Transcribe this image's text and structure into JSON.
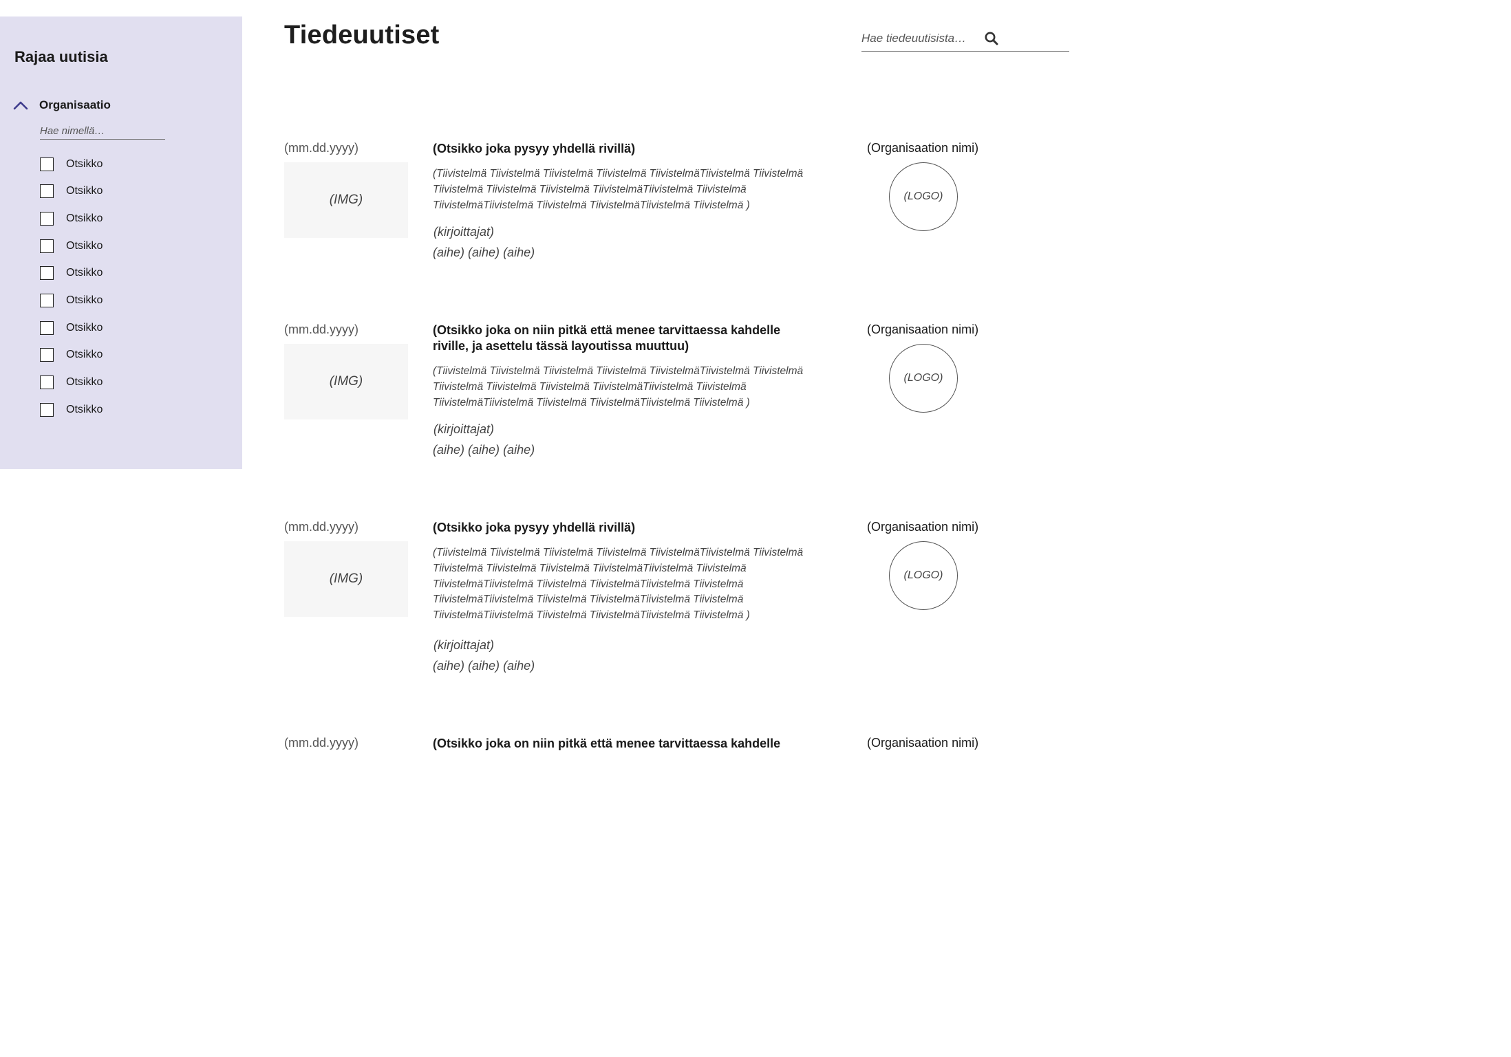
{
  "sidebar": {
    "title": "Rajaa uutisia",
    "filter_group_label": "Organisaatio",
    "org_search_placeholder": "Hae nimellä…",
    "checkbox_labels": [
      "Otsikko",
      "Otsikko",
      "Otsikko",
      "Otsikko",
      "Otsikko",
      "Otsikko",
      "Otsikko",
      "Otsikko",
      "Otsikko",
      "Otsikko"
    ]
  },
  "header": {
    "title": "Tiedeuutiset",
    "search_placeholder": "Hae tiedeuutisista…"
  },
  "articles": [
    {
      "date": "(mm.dd.yyyy)",
      "img": "(IMG)",
      "title": "(Otsikko joka pysyy yhdellä rivillä)",
      "summary": "(Tiivistelmä Tiivistelmä Tiivistelmä Tiivistelmä TiivistelmäTiivistelmä Tiivistelmä Tiivistelmä Tiivistelmä Tiivistelmä TiivistelmäTiivistelmä Tiivistelmä TiivistelmäTiivistelmä Tiivistelmä TiivistelmäTiivistelmä Tiivistelmä )",
      "authors": "(kirjoittajat)",
      "topics": [
        "(aihe)",
        "(aihe)",
        "(aihe)"
      ],
      "org_name": "(Organisaation nimi)",
      "logo": "(LOGO)"
    },
    {
      "date": "(mm.dd.yyyy)",
      "img": "(IMG)",
      "title": "(Otsikko joka on niin pitkä että menee tarvittaessa kahdelle riville, ja asettelu tässä layoutissa muuttuu)",
      "summary": "(Tiivistelmä Tiivistelmä Tiivistelmä Tiivistelmä TiivistelmäTiivistelmä Tiivistelmä Tiivistelmä Tiivistelmä Tiivistelmä TiivistelmäTiivistelmä Tiivistelmä TiivistelmäTiivistelmä Tiivistelmä TiivistelmäTiivistelmä Tiivistelmä )",
      "authors": "(kirjoittajat)",
      "topics": [
        "(aihe)",
        "(aihe)",
        "(aihe)"
      ],
      "org_name": "(Organisaation nimi)",
      "logo": "(LOGO)"
    },
    {
      "date": "(mm.dd.yyyy)",
      "img": "(IMG)",
      "title": "(Otsikko joka pysyy yhdellä rivillä)",
      "summary": "(Tiivistelmä Tiivistelmä Tiivistelmä Tiivistelmä TiivistelmäTiivistelmä Tiivistelmä Tiivistelmä Tiivistelmä Tiivistelmä TiivistelmäTiivistelmä Tiivistelmä TiivistelmäTiivistelmä Tiivistelmä TiivistelmäTiivistelmä Tiivistelmä TiivistelmäTiivistelmä Tiivistelmä TiivistelmäTiivistelmä Tiivistelmä TiivistelmäTiivistelmä Tiivistelmä TiivistelmäTiivistelmä Tiivistelmä )",
      "authors": "(kirjoittajat)",
      "topics": [
        "(aihe)",
        "(aihe)",
        "(aihe)"
      ],
      "org_name": "(Organisaation nimi)",
      "logo": "(LOGO)"
    },
    {
      "date": "(mm.dd.yyyy)",
      "title": "(Otsikko joka on niin pitkä että menee tarvittaessa kahdelle",
      "org_name": "(Organisaation nimi)"
    }
  ],
  "colors": {
    "sidebar_bg": "#e1dff0",
    "accent": "#3d3a8c",
    "img_placeholder_bg": "#f6f6f6"
  },
  "icons": {
    "collapse": "chevron-up-icon",
    "search": "search-icon"
  }
}
